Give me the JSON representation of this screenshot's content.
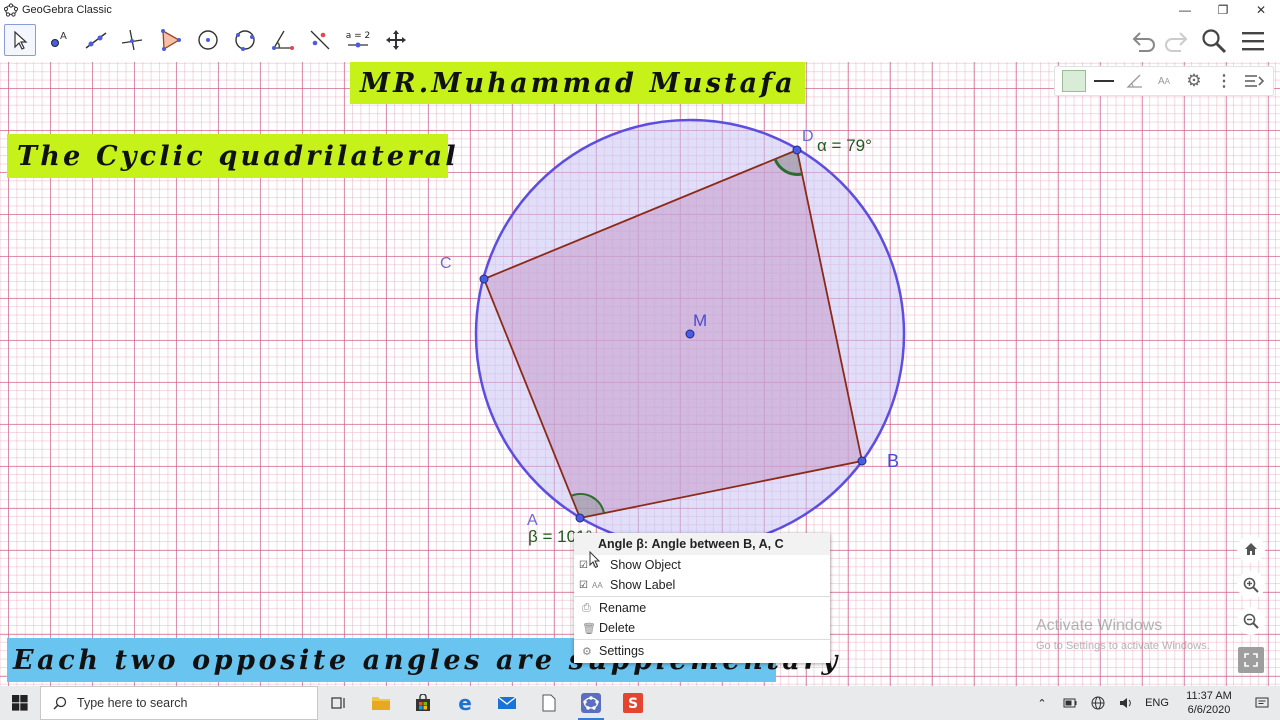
{
  "window": {
    "title": "GeoGebra Classic",
    "controls": [
      "minimize",
      "restore",
      "close"
    ]
  },
  "toolbar": {
    "tools": [
      "move-tool",
      "point-tool",
      "line-tool",
      "perpendicular-line-tool",
      "polygon-tool",
      "circle-center-point-tool",
      "circle-three-points-tool",
      "angle-tool",
      "reflect-tool",
      "slider-tool",
      "move-graphics-view-tool"
    ],
    "slider_label": "a = 2",
    "right": [
      "undo",
      "redo",
      "search",
      "menu"
    ]
  },
  "banners": {
    "name": "MR.Muhammad Mustafa",
    "title": "The Cyclic quadrilateral",
    "footer": "Each two opposite angles are supplementary"
  },
  "figure": {
    "points": {
      "A": "A",
      "B": "B",
      "C": "C",
      "D": "D",
      "M": "M"
    },
    "angle_alpha": "α = 79°",
    "angle_beta": "β = 101°",
    "colors": {
      "circle": "#5c4ee0",
      "circle_fill": "#c9c3f5",
      "polygon": "#8b2a17",
      "polygon_fill": "#c59ac8",
      "angle": "#2e6b2e",
      "point": "#4a5de0"
    }
  },
  "context_menu": {
    "header": "Angle β: Angle between B, A, C",
    "items": [
      "Show Object",
      "Show Label",
      "Rename",
      "Delete",
      "Settings"
    ]
  },
  "watermark": {
    "line1": "Activate Windows",
    "line2": "Go to Settings to activate Windows."
  },
  "taskbar": {
    "search_placeholder": "Type here to search",
    "tray_language": "ENG",
    "time": "11:37 AM",
    "date": "6/6/2020"
  }
}
